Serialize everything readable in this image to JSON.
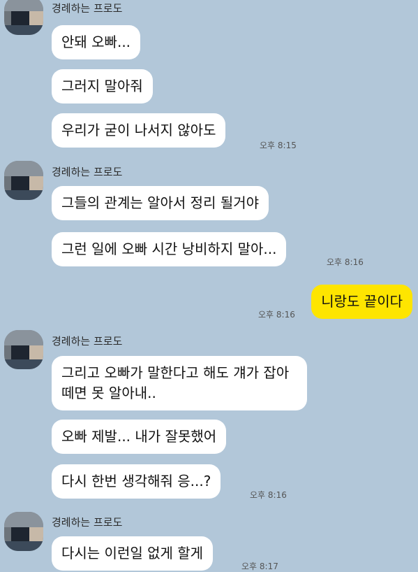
{
  "chat": {
    "sender_name": "경례하는 프로도",
    "groups": [
      {
        "messages": [
          "안돼 오빠...",
          "그러지 말아줘",
          "우리가 굳이 나서지 않아도"
        ],
        "time": "오후 8:15"
      },
      {
        "messages": [
          "그들의 관계는 알아서 정리 될거야",
          "그런 일에 오빠 시간 낭비하지 말아..."
        ],
        "time": "오후 8:16"
      },
      {
        "messages": [
          "그리고 오빠가 말한다고 해도 걔가 잡아떼면 못 알아내..",
          "오빠 제발... 내가 잘못했어",
          "다시 한번 생각해줘 응...?"
        ],
        "time": "오후 8:16"
      },
      {
        "messages": [
          "다시는 이런일 없게 할게"
        ],
        "time": "오후 8:17"
      }
    ],
    "my_message": {
      "text": "니랑도 끝이다",
      "time": "오후 8:16"
    }
  }
}
